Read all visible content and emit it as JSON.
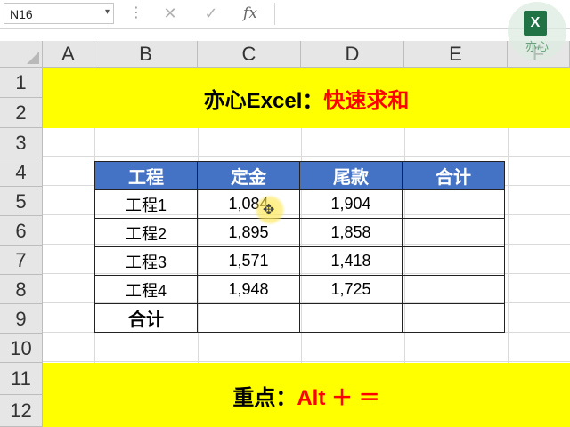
{
  "formula_bar": {
    "name_box": "N16",
    "name_box_arrow": "▾",
    "cancel_glyph": "✕",
    "enter_glyph": "✓",
    "fx_label": "fx",
    "formula": ""
  },
  "logo": {
    "glyph": "X",
    "text": "亦心"
  },
  "columns": [
    "A",
    "B",
    "C",
    "D",
    "E",
    "F"
  ],
  "rows": [
    "1",
    "2",
    "3",
    "4",
    "5",
    "6",
    "7",
    "8",
    "9",
    "10",
    "11",
    "12"
  ],
  "title_banner": {
    "part1": "亦心Excel：",
    "part2": "快速求和"
  },
  "table": {
    "headers": [
      "工程",
      "定金",
      "尾款",
      "合计"
    ],
    "rows": [
      [
        "工程1",
        "1,084",
        "1,904",
        ""
      ],
      [
        "工程2",
        "1,895",
        "1,858",
        ""
      ],
      [
        "工程3",
        "1,571",
        "1,418",
        ""
      ],
      [
        "工程4",
        "1,948",
        "1,725",
        ""
      ]
    ],
    "total_label": "合计"
  },
  "key_banner": {
    "part1": "重点：",
    "part2": "Alt ＋ ＝"
  },
  "colors": {
    "banner": "#ffff00",
    "header_fill": "#4472c4",
    "accent_red": "#ff0000",
    "excel_green": "#217346"
  },
  "icons": {
    "cancel": "close-icon",
    "enter": "check-icon",
    "cursor": "move-cursor-icon"
  }
}
